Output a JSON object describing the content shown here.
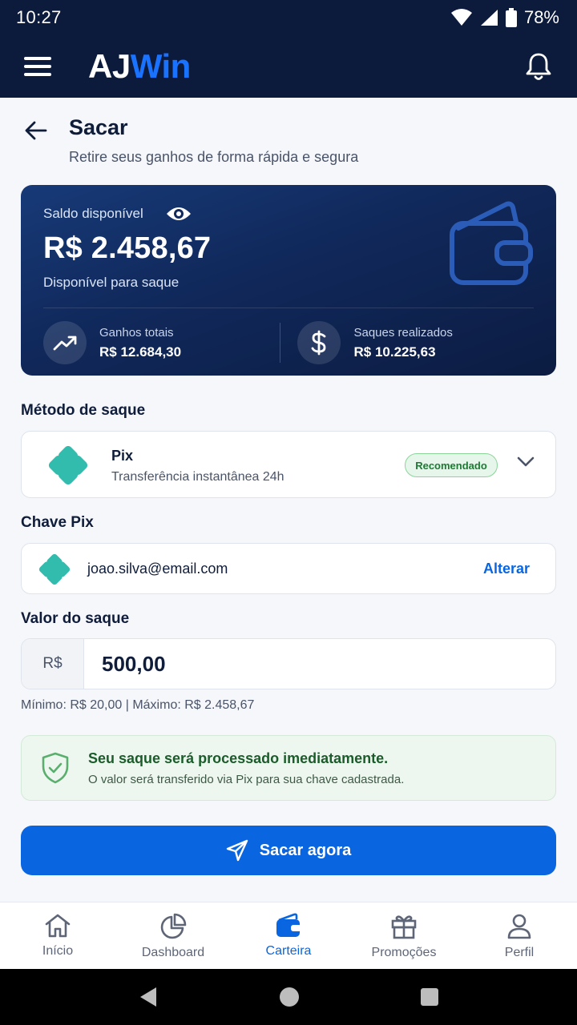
{
  "status_bar": {
    "time": "10:27",
    "battery": "78%"
  },
  "header": {
    "logo_part1": "AJ",
    "logo_part2": "Win"
  },
  "page": {
    "title": "Sacar",
    "subtitle": "Retire seus ganhos de forma rápida e segura"
  },
  "balance": {
    "label": "Saldo disponível",
    "value": "R$ 2.458,67",
    "note": "Disponível para saque",
    "stats": [
      {
        "label": "Ganhos totais",
        "value": "R$ 12.684,30"
      },
      {
        "label": "Saques realizados",
        "value": "R$ 10.225,63"
      }
    ]
  },
  "method": {
    "section_label": "Método de saque",
    "name": "Pix",
    "description": "Transferência instantânea 24h",
    "badge": "Recomendado"
  },
  "pix_key": {
    "section_label": "Chave Pix",
    "value": "joao.silva@email.com",
    "change_label": "Alterar"
  },
  "amount": {
    "section_label": "Valor do saque",
    "currency": "R$",
    "value": "500,00",
    "limits": "Mínimo: R$ 20,00 | Máximo: R$ 2.458,67"
  },
  "notice": {
    "title": "Seu saque será processado imediatamente.",
    "text": "O valor será transferido via Pix para sua chave cadastrada."
  },
  "cta": {
    "label": "Sacar agora"
  },
  "bottom_nav": {
    "items": [
      {
        "label": "Início",
        "icon": "home-icon"
      },
      {
        "label": "Dashboard",
        "icon": "pie-chart-icon"
      },
      {
        "label": "Carteira",
        "icon": "wallet-icon"
      },
      {
        "label": "Promoções",
        "icon": "gift-icon"
      },
      {
        "label": "Perfil",
        "icon": "user-icon"
      }
    ],
    "active_index": 2
  },
  "colors": {
    "primary": "#0a66e0",
    "header_bg": "#0c1a3c",
    "pix_teal": "#32bcad",
    "success_green": "#1d7a34"
  }
}
